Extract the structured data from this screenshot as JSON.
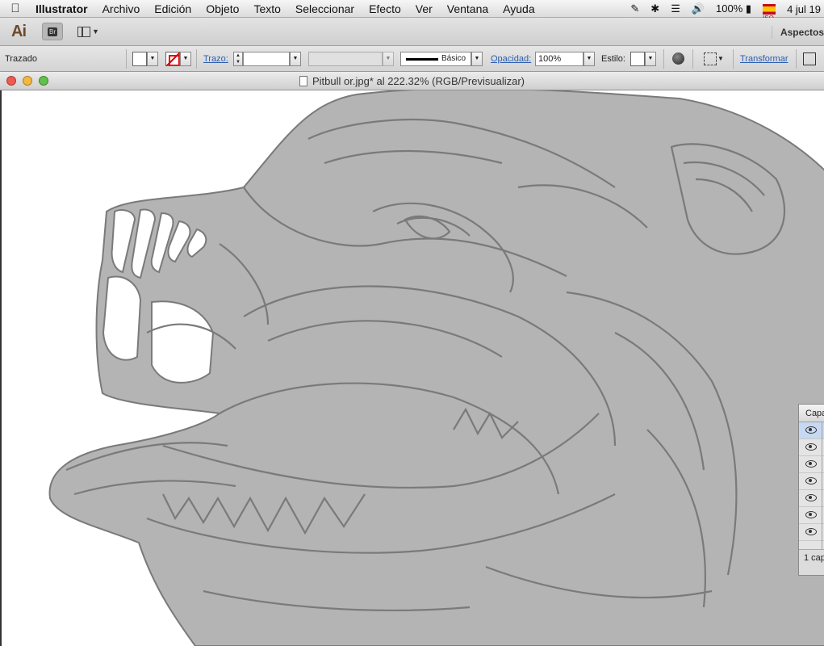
{
  "menubar": {
    "apple_icon": "",
    "items": [
      "Illustrator",
      "Archivo",
      "Edición",
      "Objeto",
      "Texto",
      "Seleccionar",
      "Efecto",
      "Ver",
      "Ventana",
      "Ayuda"
    ],
    "battery": "100%",
    "flag_label": "ISO",
    "date": "4 jul  19"
  },
  "appbar": {
    "logo": "Ai",
    "bridge_label": "Br",
    "workspace": "Aspectos"
  },
  "control": {
    "selection_label": "Trazado",
    "stroke_label": "Trazo:",
    "stroke_profile": "Básico",
    "opacity_label": "Opacidad:",
    "opacity_value": "100%",
    "style_label": "Estilo:",
    "transform_label": "Transformar"
  },
  "document": {
    "title": "Pitbull or.jpg* al 222.32% (RGB/Previsualizar)"
  },
  "layers_panel": {
    "title": "Capa",
    "footer": "1 cap"
  },
  "colors": {
    "sketch_fill": "#b4b4b4",
    "sketch_line": "#7a7a7a",
    "close": "#ee5a52",
    "minimize": "#f5b83e",
    "zoom": "#5fc24a"
  }
}
